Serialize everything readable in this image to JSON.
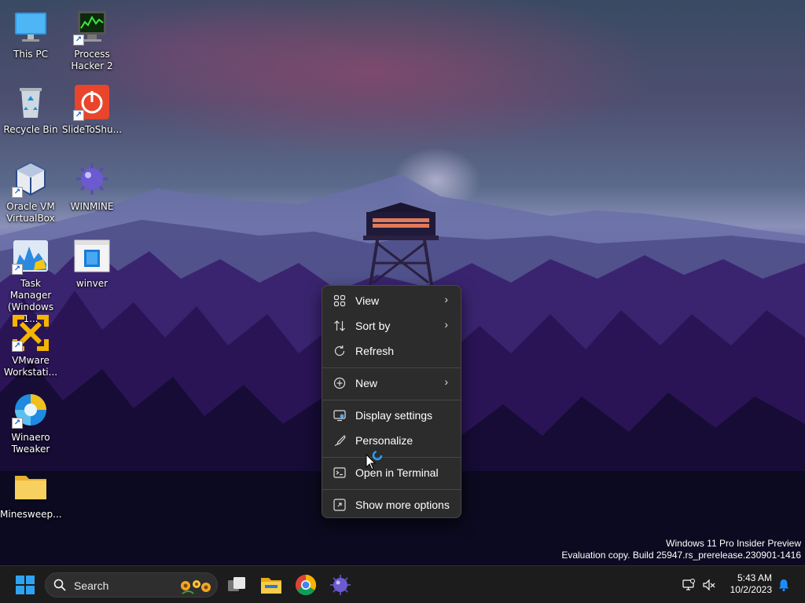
{
  "desktop": {
    "icons": [
      {
        "label": "This PC"
      },
      {
        "label": "Process Hacker 2"
      },
      {
        "label": "Recycle Bin"
      },
      {
        "label": "SlideToShu..."
      },
      {
        "label": "Oracle VM VirtualBox"
      },
      {
        "label": "WINMINE"
      },
      {
        "label": "Task Manager (Windows 1..."
      },
      {
        "label": "winver"
      },
      {
        "label": "VMware Workstati..."
      },
      {
        "label": "Winaero Tweaker"
      },
      {
        "label": "Minesweep..."
      }
    ],
    "watermark": {
      "line1": "Windows 11 Pro Insider Preview",
      "line2": "Evaluation copy. Build 25947.rs_prerelease.230901-1416"
    }
  },
  "context_menu": {
    "items": [
      {
        "label": "View",
        "icon": "view-grid-icon",
        "submenu": true
      },
      {
        "label": "Sort by",
        "icon": "sort-icon",
        "submenu": true
      },
      {
        "label": "Refresh",
        "icon": "refresh-icon",
        "submenu": false
      },
      {
        "label": "New",
        "icon": "new-plus-icon",
        "submenu": true
      },
      {
        "label": "Display settings",
        "icon": "display-icon",
        "submenu": false
      },
      {
        "label": "Personalize",
        "icon": "brush-icon",
        "submenu": false
      },
      {
        "label": "Open in Terminal",
        "icon": "terminal-icon",
        "submenu": false
      },
      {
        "label": "Show more options",
        "icon": "more-options-icon",
        "submenu": false
      }
    ],
    "chevron": "›"
  },
  "taskbar": {
    "search_placeholder": "Search",
    "clock_time": "5:43 AM",
    "clock_date": "10/2/2023"
  },
  "colors": {
    "menu_bg": "#2c2c2c",
    "taskbar_bg": "#1c1c1c",
    "accent": "#1a8cff"
  }
}
